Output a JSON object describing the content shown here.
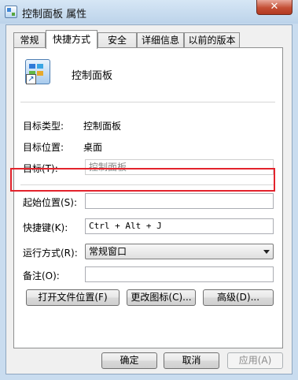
{
  "window": {
    "title": "控制面板 属性",
    "close_glyph": "✕"
  },
  "tabs": [
    {
      "label": "常规",
      "active": false
    },
    {
      "label": "快捷方式",
      "active": true
    },
    {
      "label": "安全",
      "active": false
    },
    {
      "label": "详细信息",
      "active": false
    },
    {
      "label": "以前的版本",
      "active": false
    }
  ],
  "shortcut": {
    "name": "控制面板",
    "icon": "control-panel-icon",
    "target_type_label": "目标类型:",
    "target_type_value": "控制面板",
    "target_location_label": "目标位置:",
    "target_location_value": "桌面",
    "target_label": "目标(T):",
    "target_value": "控制面板",
    "start_in_label": "起始位置(S):",
    "start_in_value": "",
    "hotkey_label": "快捷键(K):",
    "hotkey_value": "Ctrl + Alt + J",
    "run_label": "运行方式(R):",
    "run_value": "常规窗口",
    "comment_label": "备注(O):",
    "comment_value": ""
  },
  "buttons": {
    "open_location": "打开文件位置(F)",
    "change_icon": "更改图标(C)...",
    "advanced": "高级(D)...",
    "ok": "确定",
    "cancel": "取消",
    "apply": "应用(A)"
  },
  "colors": {
    "highlight": "#e3232c",
    "close_button": "#c44f35"
  }
}
